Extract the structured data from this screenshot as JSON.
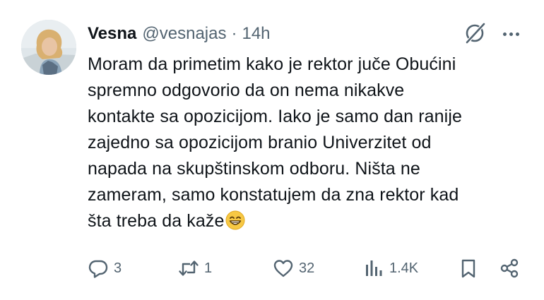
{
  "author": {
    "display_name": "Vesna",
    "handle": "@vesnajas",
    "separator": "·",
    "time": "14h"
  },
  "tweet": {
    "lines": [
      "Moram da primetim kako je rektor juče Obućini",
      "spremno odgovorio da on nema nikakve",
      "kontakte sa opozicijom. Iako je samo dan ranije",
      "zajedno sa opozicijom branio Univerzitet od",
      "napada na skupštinskom odboru. Ništa ne",
      "zameram, samo konstatujem da zna rektor kad",
      "šta treba da kaže"
    ],
    "emoji": "grinning-face-with-smiling-eyes"
  },
  "actions": {
    "replies": "3",
    "reposts": "1",
    "likes": "32",
    "views": "1.4K"
  },
  "icons": {
    "grok": "grok-icon",
    "more": "more-icon",
    "reply": "reply-icon",
    "repost": "repost-icon",
    "like": "heart-icon",
    "views": "views-icon",
    "bookmark": "bookmark-icon",
    "share": "share-icon"
  },
  "colors": {
    "text": "#0f1419",
    "secondary": "#536471",
    "background": "#ffffff"
  }
}
